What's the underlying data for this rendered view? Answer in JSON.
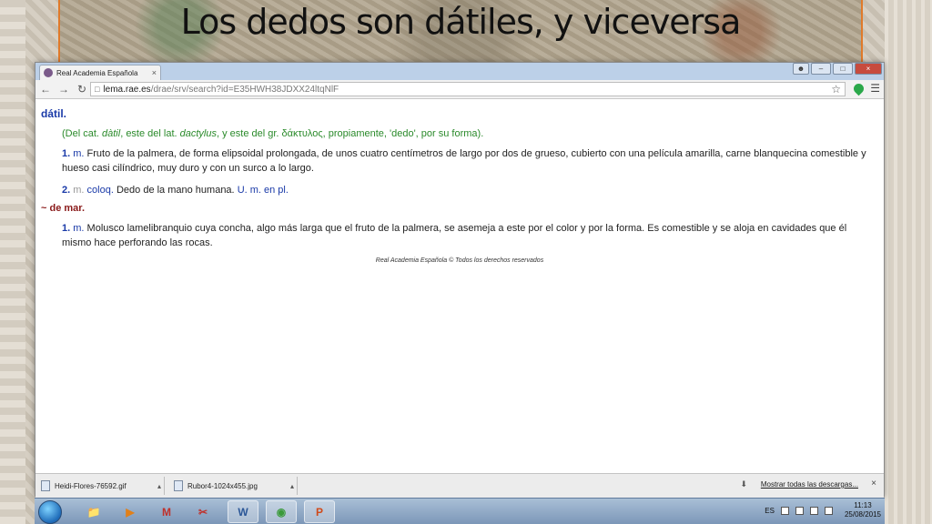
{
  "slide": {
    "title": "Los dedos son dátiles, y viceversa"
  },
  "browser": {
    "tab_title": "Real Academia Española",
    "tab_close": "×",
    "win_minimize": "–",
    "win_maximize": "□",
    "win_close": "×",
    "url_host": "lema.rae.es",
    "url_path": "/drae/srv/search?id=E35HWH38JDXX24ltqNlF"
  },
  "entry": {
    "headword": "dátil.",
    "etym_prefix": "(Del cat. ",
    "etym_w1": "dàtil",
    "etym_mid1": ", este del lat. ",
    "etym_w2": "dactylus",
    "etym_suffix": ", y este del gr. δάκτυλος, propiamente, 'dedo', por su forma).",
    "senses": [
      {
        "num": "1.",
        "abbr": "m.",
        "text": "Fruto de la palmera, de forma elipsoidal prolongada, de unos cuatro centímetros de largo por dos de grueso, cubierto con una película amarilla, carne blanquecina comestible y hueso casi cilíndrico, muy duro y con un surco a lo largo."
      },
      {
        "num": "2.",
        "abbr_gray": "m.",
        "abbr2": "coloq.",
        "text": "Dedo de la mano humana.",
        "usage": "U. m. en pl."
      }
    ],
    "sub_entry": "~ de mar.",
    "sub_senses": [
      {
        "num": "1.",
        "abbr": "m.",
        "text": "Molusco lamelibranquio cuya concha, algo más larga que el fruto de la palmera, se asemeja a este por el color y por la forma. Es comestible y se aloja en cavidades que él mismo hace perforando las rocas."
      }
    ],
    "footer": "Real Academia Española © Todos los derechos reservados"
  },
  "downloads": {
    "items": [
      "Heidi-Flores-76592.gif",
      "Rubor4-1024x455.jpg"
    ],
    "show_all": "Mostrar todas las descargas...",
    "close": "×"
  },
  "taskbar": {
    "lang": "ES",
    "time": "11:13",
    "date": "25/08/2015",
    "word_label": "W",
    "ppt_label": "P",
    "mail_label": "M"
  },
  "colors": {
    "headword": "#1a3aa8",
    "etymology": "#2a8a2a",
    "sub_entry": "#8a1a1a",
    "title_border": "#e07a2a"
  }
}
